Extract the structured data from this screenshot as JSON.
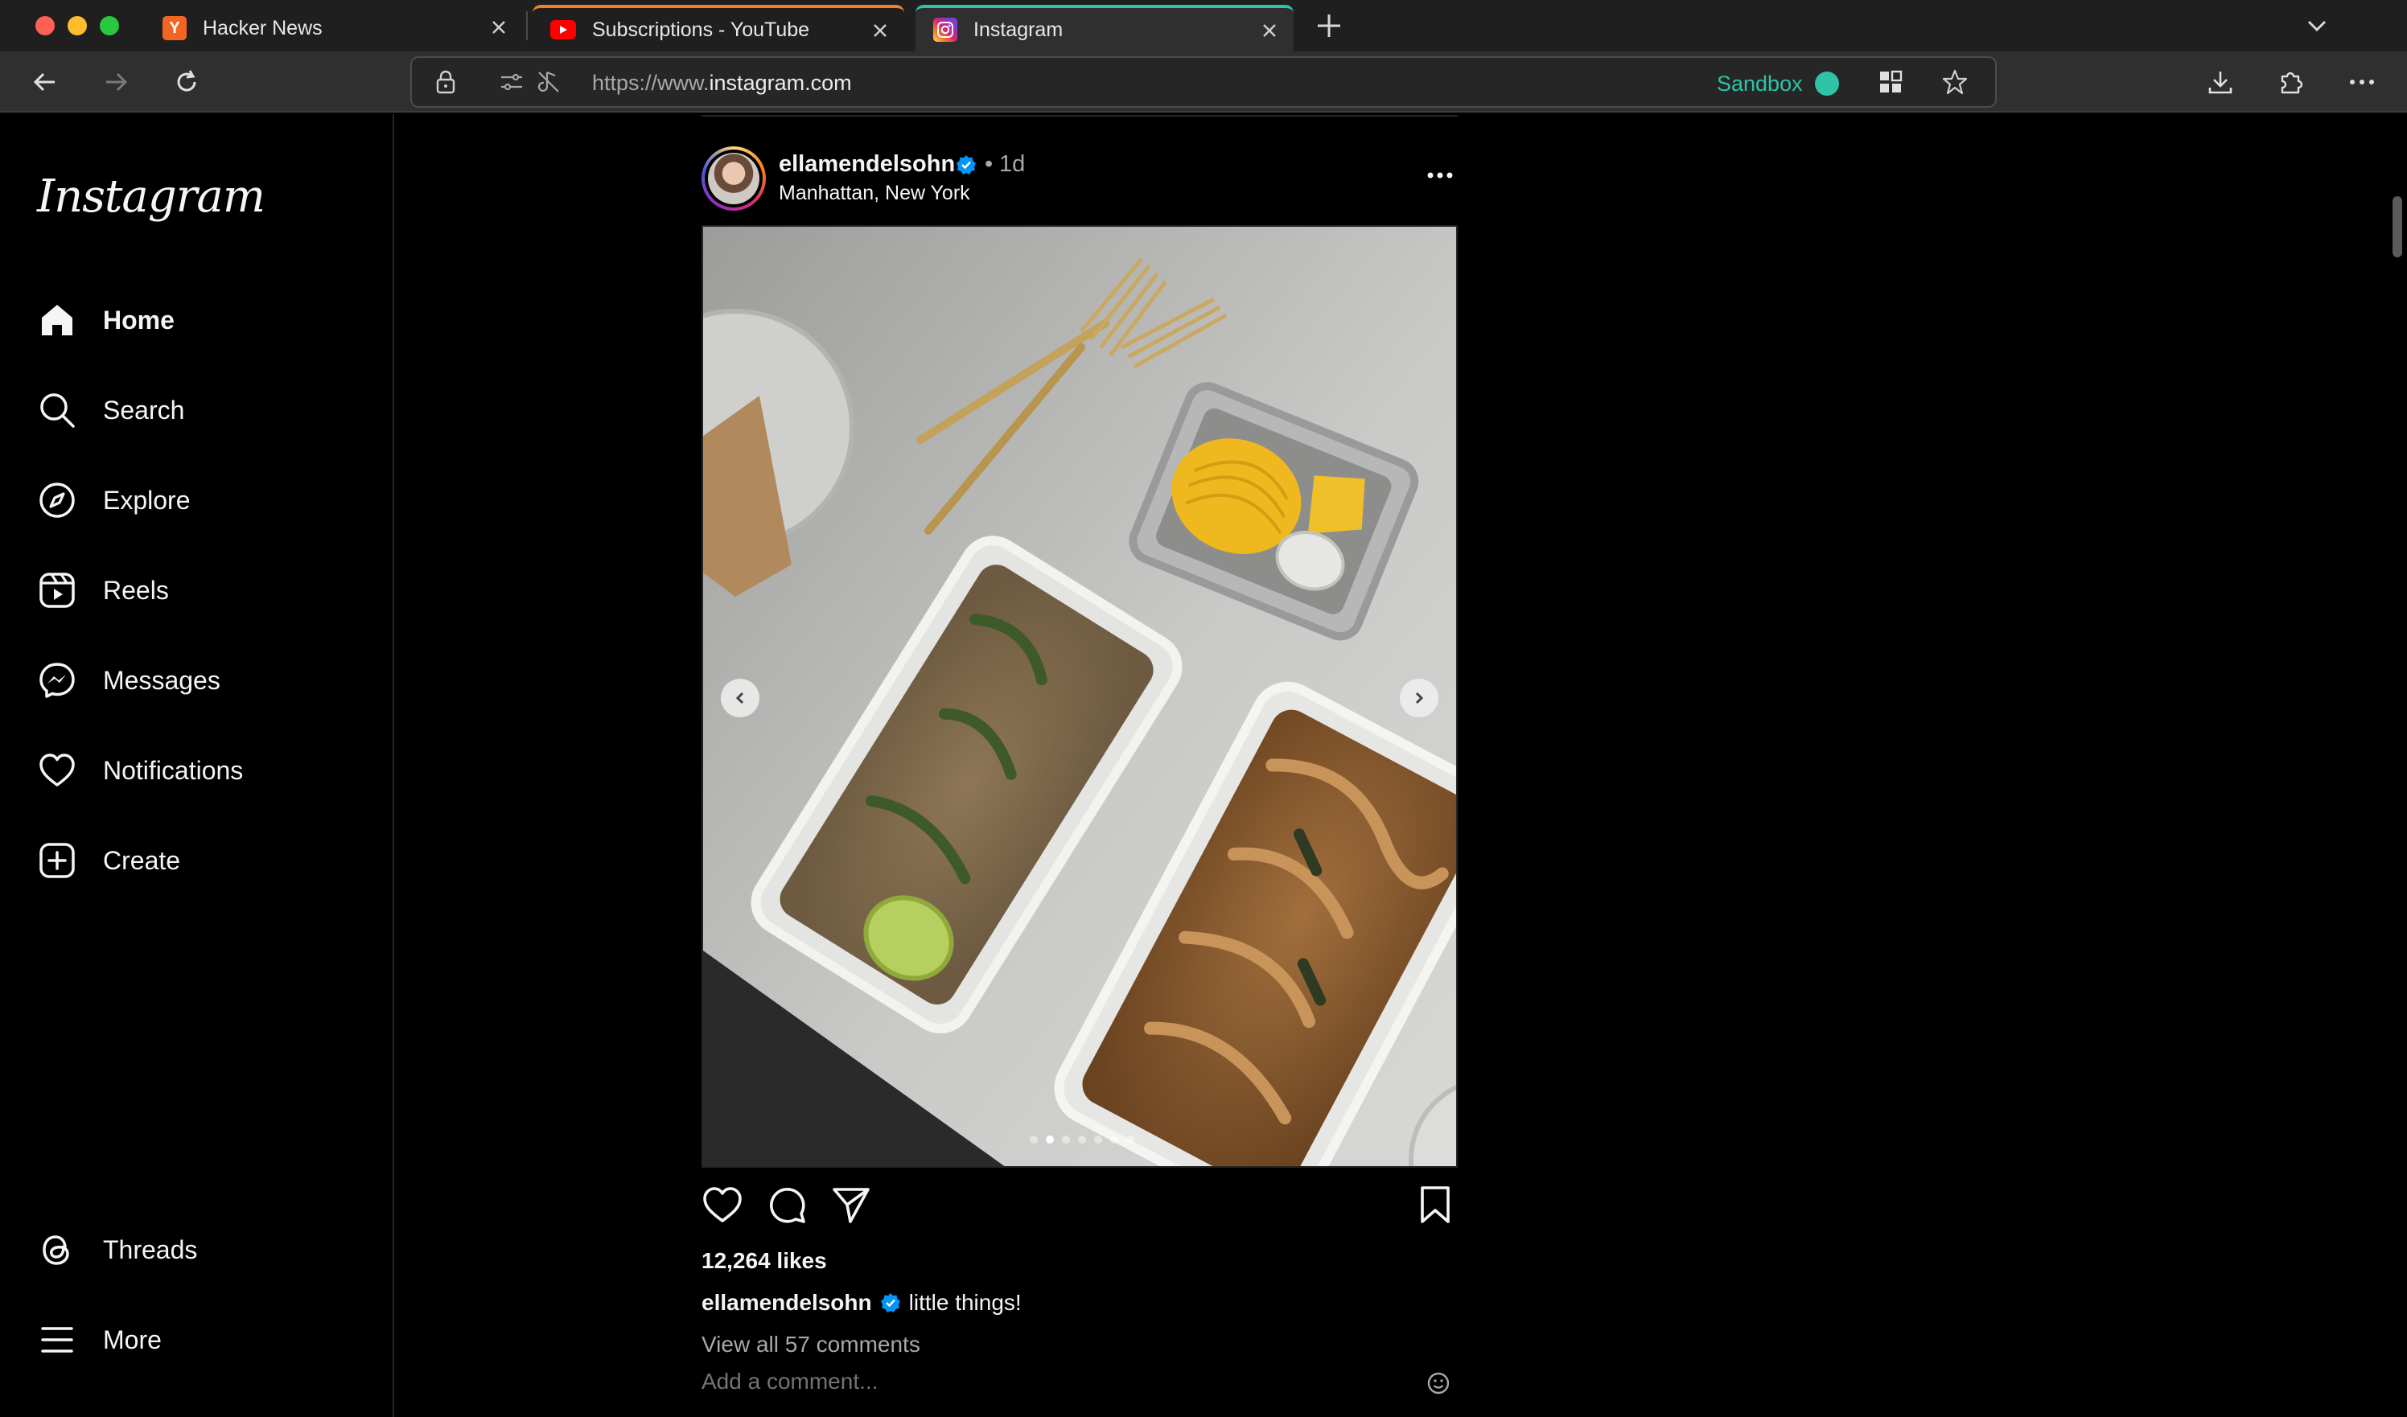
{
  "browser": {
    "tabs": [
      {
        "title": "Hacker News",
        "favicon": "hacker-news-y-icon",
        "favicon_text": "Y",
        "color": "#f26522"
      },
      {
        "title": "Subscriptions - YouTube",
        "favicon": "youtube-icon",
        "color": "#ff0000"
      },
      {
        "title": "Instagram",
        "favicon": "instagram-icon",
        "active": true
      }
    ],
    "url": {
      "scheme": "https://www.",
      "host": "instagram.com"
    },
    "sandbox_label": "Sandbox",
    "accent": "#2ec4a5"
  },
  "sidebar": {
    "logo": "Instagram",
    "items": [
      {
        "label": "Home",
        "icon": "home-icon",
        "active": true
      },
      {
        "label": "Search",
        "icon": "search-icon"
      },
      {
        "label": "Explore",
        "icon": "compass-icon"
      },
      {
        "label": "Reels",
        "icon": "reels-icon"
      },
      {
        "label": "Messages",
        "icon": "messenger-icon"
      },
      {
        "label": "Notifications",
        "icon": "heart-icon"
      },
      {
        "label": "Create",
        "icon": "plus-square-icon"
      }
    ],
    "bottom_items": [
      {
        "label": "Threads",
        "icon": "threads-icon"
      },
      {
        "label": "More",
        "icon": "hamburger-menu-icon"
      }
    ]
  },
  "post": {
    "username": "ellamendelsohn",
    "verified": true,
    "separator": "•",
    "time": "1d",
    "location": "Manhattan, New York",
    "carousel": {
      "slide_count": 7,
      "active_index": 1
    },
    "likes": "12,264 likes",
    "caption_user": "ellamendelsohn",
    "caption_text": "little things!",
    "view_comments": "View all 57 comments",
    "comment_placeholder": "Add a comment..."
  }
}
